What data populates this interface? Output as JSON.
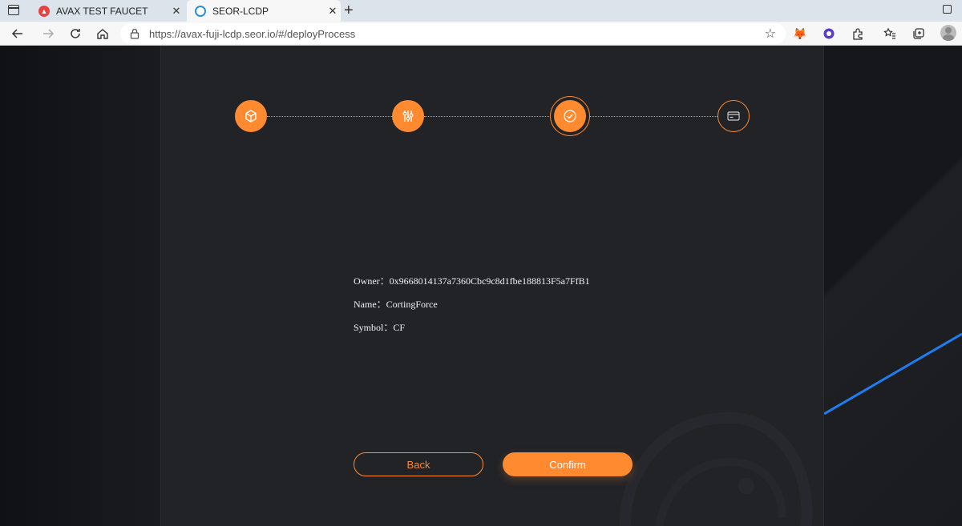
{
  "browser": {
    "tabs": [
      {
        "title": "AVAX TEST FAUCET",
        "icon": "avax-icon"
      },
      {
        "title": "SEOR-LCDP",
        "icon": "seor-icon",
        "active": true
      }
    ],
    "url": "https://avax-fuji-lcdp.seor.io/#/deployProcess"
  },
  "steps": [
    {
      "state": "done",
      "icon": "cube-icon"
    },
    {
      "state": "done",
      "icon": "sliders-icon"
    },
    {
      "state": "current",
      "icon": "check-circle-icon"
    },
    {
      "state": "pending",
      "icon": "card-icon"
    }
  ],
  "summary": {
    "owner_label": "Owner：",
    "owner_value": "0x9668014137a7360Cbc9c8d1fbe188813F5a7FfB1",
    "name_label": "Name：",
    "name_value": "CortingForce",
    "symbol_label": "Symbol：",
    "symbol_value": "CF"
  },
  "actions": {
    "back_label": "Back",
    "confirm_label": "Confirm"
  },
  "colors": {
    "accent": "#ff8a30",
    "panel": "#222327",
    "background": "#16171a",
    "line_blue": "#1e7ef0"
  }
}
